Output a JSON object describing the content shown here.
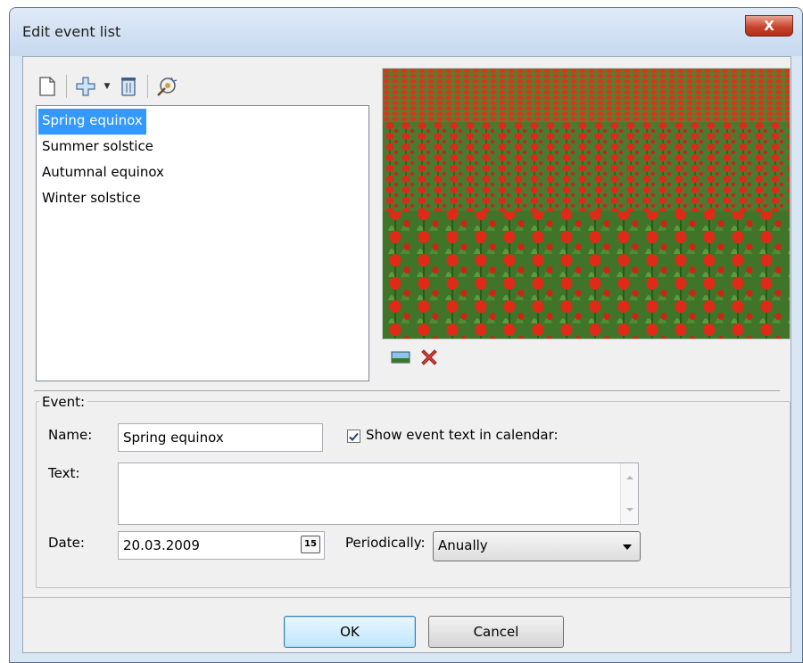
{
  "window": {
    "title": "Edit event list",
    "close_glyph": "X"
  },
  "toolbar": {
    "icons": [
      "new-icon",
      "add-icon",
      "dropdown-arrow-icon",
      "delete-icon",
      "wizard-icon"
    ],
    "dropdown_glyph": "▼"
  },
  "events": [
    {
      "label": "Spring equinox",
      "selected": true
    },
    {
      "label": "Summer solstice",
      "selected": false
    },
    {
      "label": "Autumnal equinox",
      "selected": false
    },
    {
      "label": "Winter solstice",
      "selected": false
    }
  ],
  "image_tools": {
    "icons": [
      "load-image-icon",
      "remove-image-icon"
    ]
  },
  "event_form": {
    "group_label": "Event:",
    "name_label": "Name:",
    "name_value": "Spring equinox",
    "show_text_label": "Show event text in calendar:",
    "show_text_checked": true,
    "text_label": "Text:",
    "text_value": "",
    "date_label": "Date:",
    "date_value": "20.03.2009",
    "calendar_button_text": "15",
    "periodically_label": "Periodically:",
    "periodically_value": "Anually"
  },
  "buttons": {
    "ok": "OK",
    "cancel": "Cancel"
  },
  "colors": {
    "selection": "#3399ff",
    "tulip_red": "#d8281e",
    "stem_green": "#3b6b2a"
  }
}
